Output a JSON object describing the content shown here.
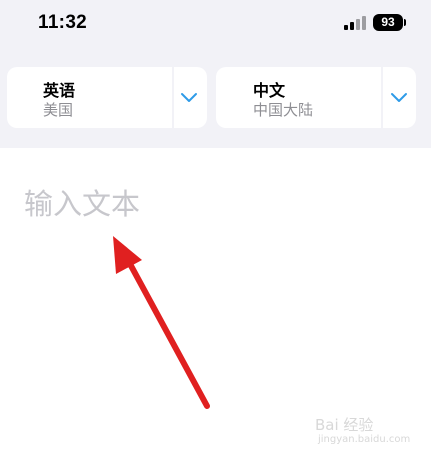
{
  "status_bar": {
    "time": "11:32",
    "battery": "93",
    "icons": [
      "signal-icon",
      "battery-icon"
    ]
  },
  "source_language": {
    "name": "英语",
    "region": "美国",
    "dropdown_icon": "chevron-down-icon"
  },
  "target_language": {
    "name": "中文",
    "region": "中国大陆",
    "dropdown_icon": "chevron-down-icon"
  },
  "input": {
    "placeholder": "输入文本",
    "value": ""
  },
  "annotation": {
    "arrow_color": "#e02020",
    "icon": "red-arrow-icon"
  },
  "watermark": {
    "text": "Bai 经验",
    "subtext": "jingyan.baidu.com"
  },
  "colors": {
    "background_top": "#f2f2f7",
    "card": "#ffffff",
    "chevron": "#2e9be8",
    "placeholder": "#c7c7cc",
    "secondary_text": "#8e8e93"
  }
}
